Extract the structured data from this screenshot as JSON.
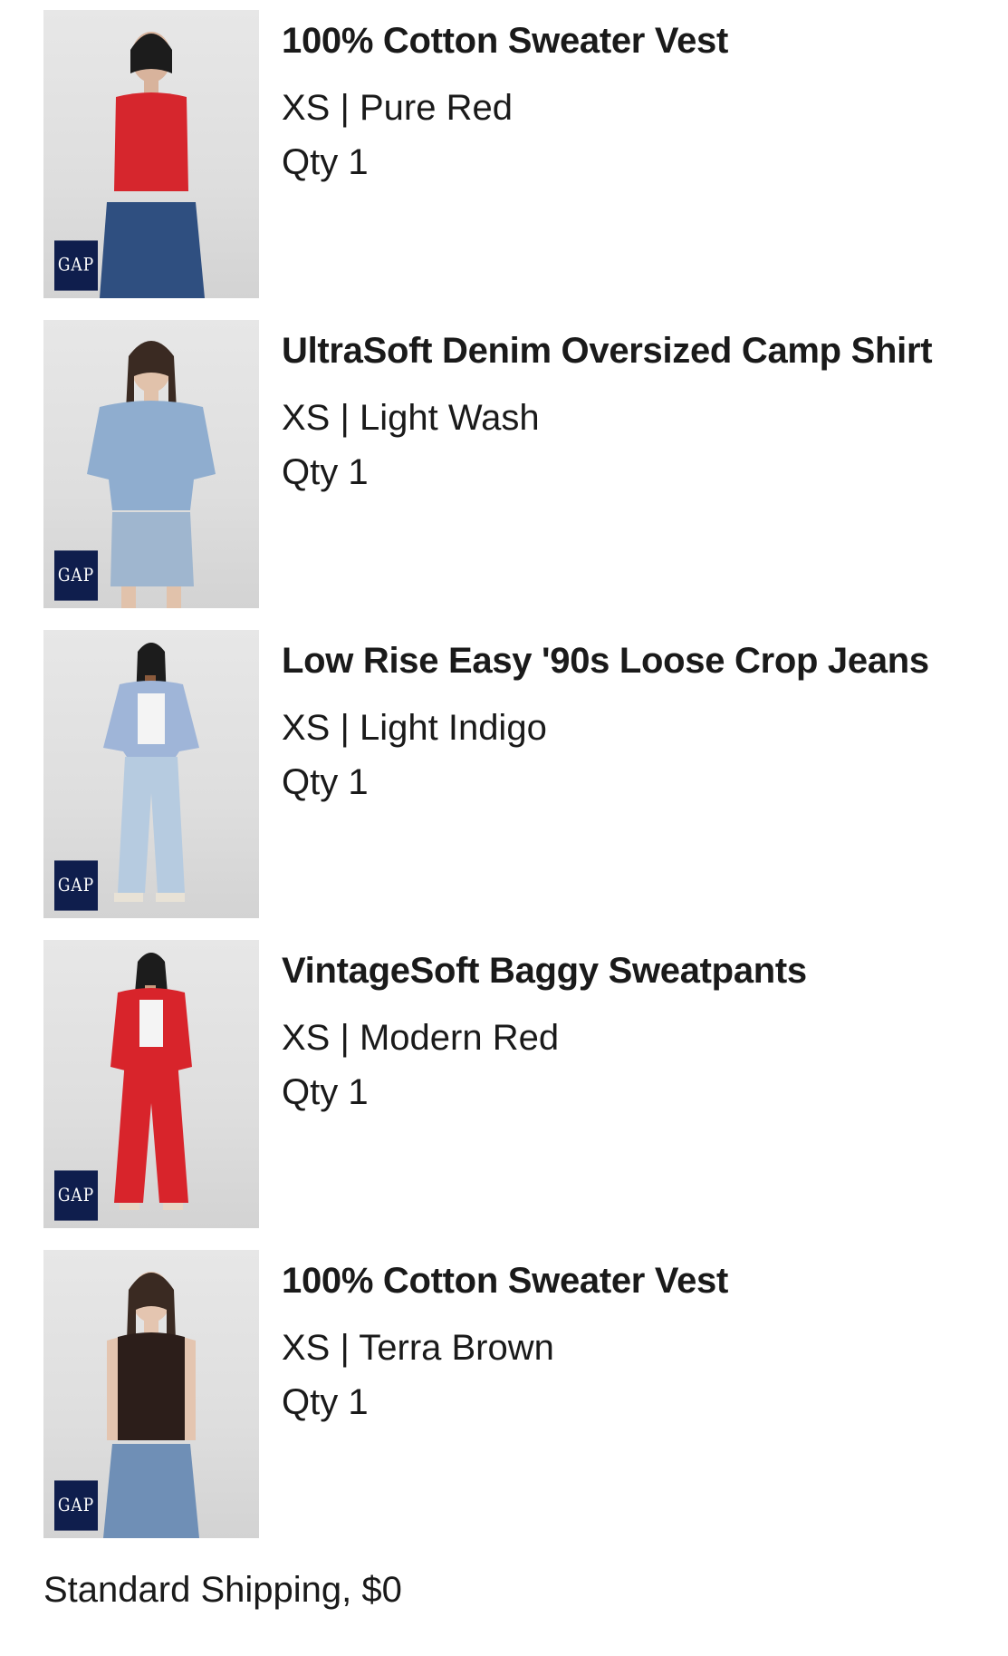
{
  "items": [
    {
      "name": "100% Cotton Sweater Vest",
      "variant": "XS | Pure Red",
      "qty": "Qty 1",
      "brand": "GAP",
      "top_color": "#d6262d",
      "bottom_color": "#2f4f80",
      "icon": "product-photo"
    },
    {
      "name": "UltraSoft Denim Oversized Camp Shirt",
      "variant": "XS | Light Wash",
      "qty": "Qty 1",
      "brand": "GAP",
      "top_color": "#8fadcf",
      "bottom_color": "#9fb6cf",
      "icon": "product-photo"
    },
    {
      "name": "Low Rise Easy '90s Loose Crop Jeans",
      "variant": "XS | Light Indigo",
      "qty": "Qty 1",
      "brand": "GAP",
      "top_color": "#9fb5d8",
      "bottom_color": "#b6cbe0",
      "icon": "product-photo"
    },
    {
      "name": "VintageSoft Baggy Sweatpants",
      "variant": "XS | Modern Red",
      "qty": "Qty 1",
      "brand": "GAP",
      "top_color": "#d8242b",
      "bottom_color": "#d8242b",
      "icon": "product-photo"
    },
    {
      "name": "100% Cotton Sweater Vest",
      "variant": "XS | Terra Brown",
      "qty": "Qty 1",
      "brand": "GAP",
      "top_color": "#2c1e1a",
      "bottom_color": "#6f8fb6",
      "icon": "product-photo"
    }
  ],
  "shipping": "Standard Shipping, $0"
}
